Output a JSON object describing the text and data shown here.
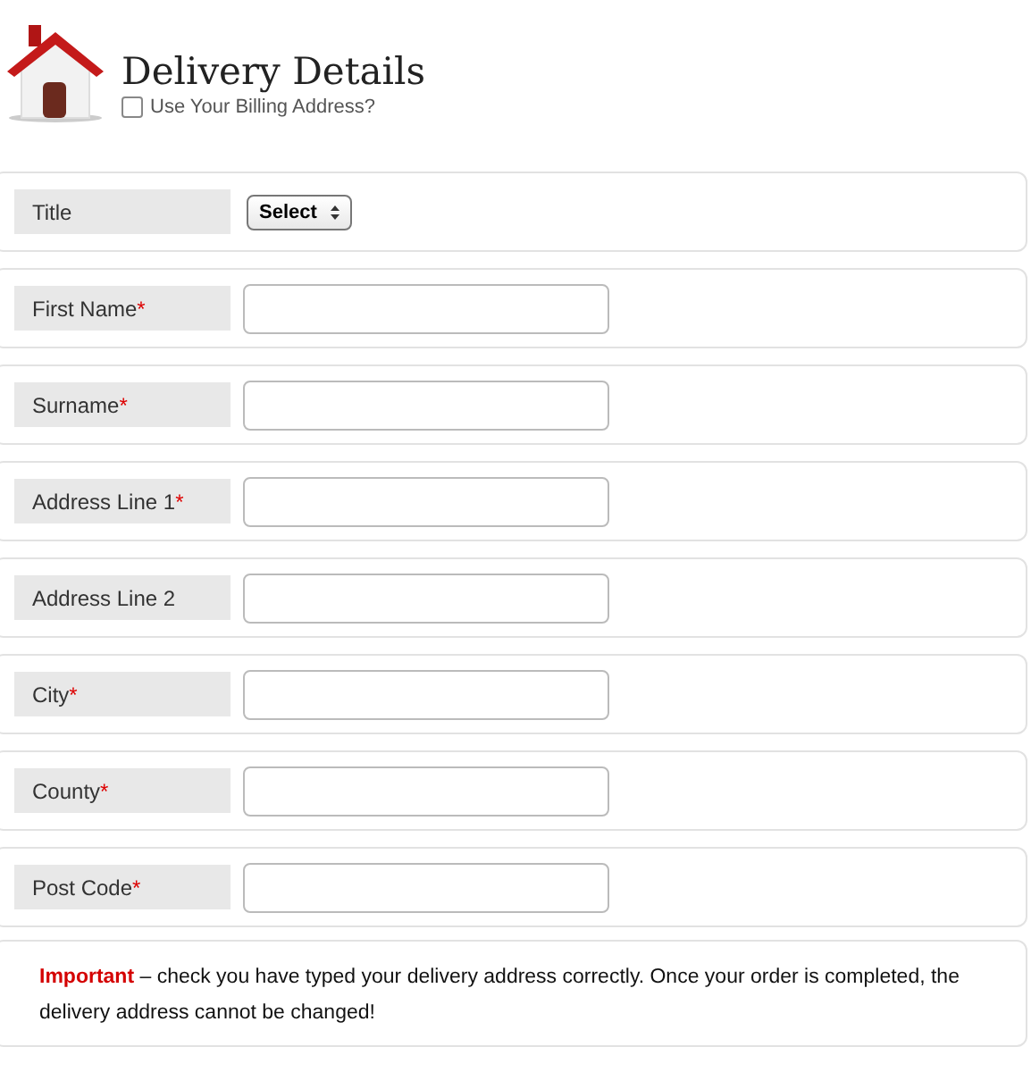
{
  "header": {
    "title": "Delivery Details",
    "billing_checkbox": {
      "label": "Use Your Billing Address?",
      "checked": false
    }
  },
  "fields": [
    {
      "kind": "select",
      "label": "Title",
      "value": "Select"
    },
    {
      "kind": "text",
      "label": "First Name",
      "required_mark": "*"
    },
    {
      "kind": "text",
      "label": "Surname",
      "required_mark": "*"
    },
    {
      "kind": "text",
      "label": "Address Line 1",
      "required_mark": "*"
    },
    {
      "kind": "text",
      "label": "Address Line 2"
    },
    {
      "kind": "text",
      "label": "City",
      "required_mark": "*"
    },
    {
      "kind": "text",
      "label": "County",
      "required_mark": "*"
    },
    {
      "kind": "text",
      "label": "Post Code",
      "required_mark": "*"
    }
  ],
  "notice": {
    "lead": "Important",
    "text": "– check you have typed your delivery address correctly. Once your order is completed, the delivery address cannot be changed!"
  }
}
